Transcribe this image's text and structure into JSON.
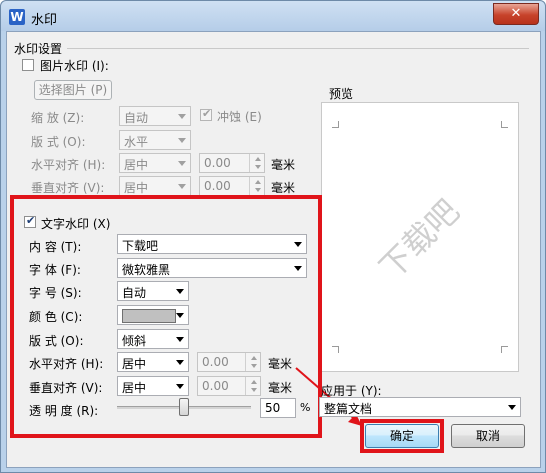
{
  "window": {
    "title": "水印",
    "app_icon_letter": "W",
    "close_glyph": "✕"
  },
  "group": {
    "label": "水印设置"
  },
  "picture": {
    "checkbox_label": "图片水印 (I):",
    "select_button": "选择图片 (P)",
    "scale_label": "缩 放 (Z):",
    "scale_value": "自动",
    "washout_label": "冲蚀 (E)",
    "layout_label": "版 式 (O):",
    "layout_value": "水平",
    "h_align_label": "水平对齐 (H):",
    "h_align_value": "居中",
    "h_offset_value": "0.00",
    "h_unit": "毫米",
    "v_align_label": "垂直对齐 (V):",
    "v_align_value": "居中",
    "v_offset_value": "0.00",
    "v_unit": "毫米"
  },
  "text": {
    "checkbox_label": "文字水印 (X)",
    "content_label": "内 容 (T):",
    "content_value": "下载吧",
    "font_label": "字 体 (F):",
    "font_value": "微软雅黑",
    "size_label": "字 号 (S):",
    "size_value": "自动",
    "color_label": "颜 色 (C):",
    "layout_label": "版 式 (O):",
    "layout_value": "倾斜",
    "h_align_label": "水平对齐 (H):",
    "h_align_value": "居中",
    "h_offset_value": "0.00",
    "h_unit": "毫米",
    "v_align_label": "垂直对齐 (V):",
    "v_align_value": "居中",
    "v_offset_value": "0.00",
    "v_unit": "毫米",
    "transparency_label": "透 明 度 (R):",
    "transparency_value": "50",
    "transparency_unit": "%"
  },
  "preview": {
    "label": "预览",
    "watermark_text": "下载吧"
  },
  "apply": {
    "label": "应用于 (Y):",
    "value": "整篇文档"
  },
  "buttons": {
    "ok": "确定",
    "cancel": "取消"
  },
  "colors": {
    "highlight": "#e0141a",
    "watermark_color": "#c0c0c0",
    "title_bar": "#b9d1ea"
  },
  "icons": [
    "app-icon",
    "close-icon",
    "dropdown-arrow-icon",
    "checkmark-icon",
    "spin-up-icon",
    "spin-down-icon"
  ]
}
